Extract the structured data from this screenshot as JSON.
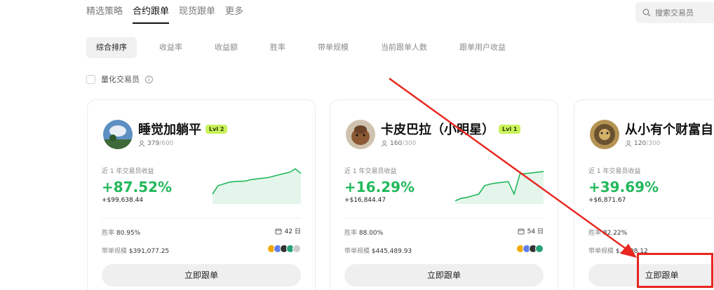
{
  "nav": {
    "tabs": [
      "精选策略",
      "合约跟单",
      "现货跟单",
      "更多"
    ],
    "active_index": 1
  },
  "search": {
    "placeholder": "搜索交易员"
  },
  "sorts": {
    "items": [
      "综合排序",
      "收益率",
      "收益额",
      "胜率",
      "带单规模",
      "当前跟单人数",
      "跟单用户收益"
    ],
    "active_index": 0
  },
  "quant_filter": {
    "label": "量化交易员",
    "info_icon": "info-icon"
  },
  "cards": [
    {
      "name": "睡觉加躺平",
      "level": "Lvl 2",
      "followers": "379",
      "followers_max": "/600",
      "profit_label": "近 1 年交易员收益",
      "profit_pct": "+87.52%",
      "profit_usd": "+$99,638.44",
      "win_rate_label": "胜率",
      "win_rate": "80.95%",
      "days": "42 日",
      "aum_label": "带单规模",
      "aum": "$391,077.25",
      "follow_btn": "立即跟单",
      "sparkline": [
        0.25,
        0.5,
        0.55,
        0.6,
        0.62,
        0.63,
        0.64,
        0.68,
        0.7,
        0.72,
        0.74,
        0.78,
        0.82,
        0.86,
        0.9,
        1.0,
        0.86
      ],
      "accent": "#22b85c"
    },
    {
      "name": "卡皮巴拉（小明星）",
      "level": "Lvl 1",
      "followers": "160",
      "followers_max": "/300",
      "profit_label": "近 1 年交易员收益",
      "profit_pct": "+16.29%",
      "profit_usd": "+$16,844.47",
      "win_rate_label": "胜率",
      "win_rate": "88.00%",
      "days": "54 日",
      "aum_label": "带单规模",
      "aum": "$445,489.93",
      "follow_btn": "立即跟单",
      "sparkline": [
        0.05,
        0.12,
        0.15,
        0.2,
        0.25,
        0.5,
        0.55,
        0.58,
        0.6,
        0.62,
        0.25,
        0.85,
        0.86,
        0.88,
        0.9,
        0.92
      ],
      "accent": "#22b85c"
    },
    {
      "name": "从小有个财富自",
      "level": "",
      "followers": "120",
      "followers_max": "/300",
      "profit_label": "近 1 年交易员收益",
      "profit_pct": "+39.69%",
      "profit_usd": "+$6,871.67",
      "win_rate_label": "胜率",
      "win_rate": "82.22%",
      "days": "",
      "aum_label": "带单规模",
      "aum": "$...808.12",
      "follow_btn": "立即跟单",
      "sparkline": [],
      "accent": "#22b85c"
    }
  ],
  "annotation": {
    "color": "#e8261f"
  }
}
